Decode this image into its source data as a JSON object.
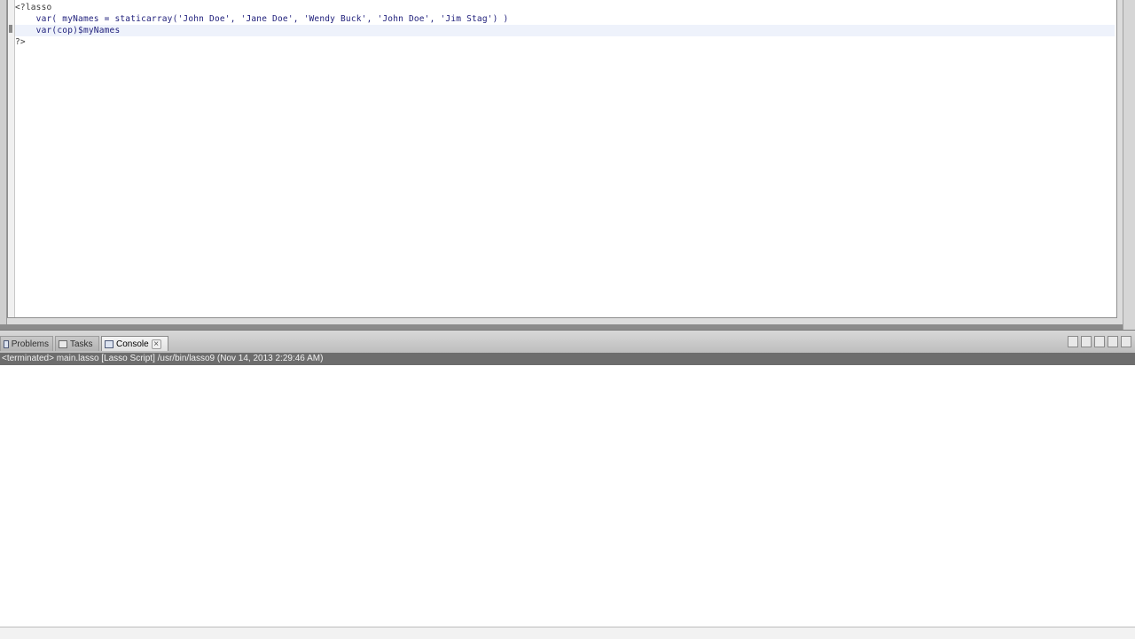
{
  "editor": {
    "lines": [
      "<?lasso",
      "    var( myNames = staticarray('John Doe', 'Jane Doe', 'Wendy Buck', 'John Doe', 'Jim Stag') )",
      "    var(cop)$myNames",
      "?>"
    ]
  },
  "views": {
    "tabs": [
      {
        "label": "Problems",
        "icon": "problems-icon"
      },
      {
        "label": "Tasks",
        "icon": "tasks-icon"
      },
      {
        "label": "Console",
        "icon": "console-icon",
        "active": true
      }
    ]
  },
  "console": {
    "header": "<terminated> main.lasso [Lasso Script] /usr/bin/lasso9 (Nov 14, 2013 2:29:46 AM)"
  },
  "colors": {
    "console_header_bg": "#6d6d6d",
    "current_line": "#eef2fb"
  }
}
